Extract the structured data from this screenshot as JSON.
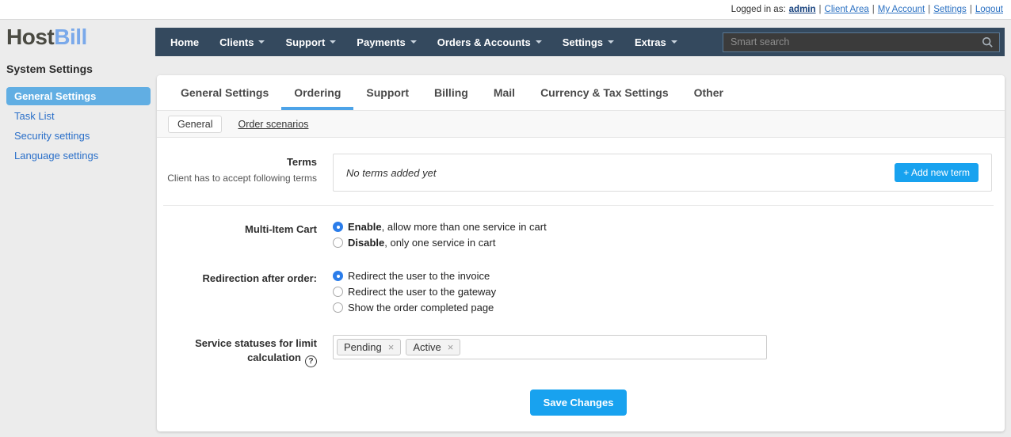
{
  "topbar": {
    "prefix": "Logged in as:",
    "username": "admin",
    "separator": "|",
    "links": [
      "Client Area",
      "My Account",
      "Settings",
      "Logout"
    ]
  },
  "brand": {
    "name_primary": "Host",
    "name_secondary": "Bill",
    "section_title": "System Settings"
  },
  "nav": {
    "items": [
      "Home",
      "Clients",
      "Support",
      "Payments",
      "Orders & Accounts",
      "Settings",
      "Extras"
    ],
    "search_placeholder": "Smart search"
  },
  "sidebar": {
    "items": [
      {
        "label": "General Settings",
        "active": true
      },
      {
        "label": "Task List",
        "active": false
      },
      {
        "label": "Security settings",
        "active": false
      },
      {
        "label": "Language settings",
        "active": false
      }
    ]
  },
  "tabs": {
    "active": "Ordering",
    "items": [
      "General Settings",
      "Ordering",
      "Support",
      "Billing",
      "Mail",
      "Currency & Tax Settings",
      "Other"
    ]
  },
  "subtabs": {
    "active": "General",
    "items": [
      "General",
      "Order scenarios"
    ]
  },
  "form": {
    "terms": {
      "label": "Terms",
      "description": "Client has to accept following terms",
      "empty_message": "No terms added yet",
      "add_button": "+ Add new term"
    },
    "multi_item_cart": {
      "label": "Multi-Item Cart",
      "options": [
        {
          "emphasis": "Enable",
          "rest": ", allow more than one service in cart",
          "selected": true
        },
        {
          "emphasis": "Disable",
          "rest": ", only one service in cart",
          "selected": false
        }
      ]
    },
    "redirection": {
      "label": "Redirection after order:",
      "options": [
        {
          "label": "Redirect the user to the invoice",
          "selected": true
        },
        {
          "label": "Redirect the user to the gateway",
          "selected": false
        },
        {
          "label": "Show the order completed page",
          "selected": false
        }
      ]
    },
    "service_statuses": {
      "label": "Service statuses for limit calculation",
      "help_icon": "?",
      "remove_icon": "×",
      "tags": [
        "Pending",
        "Active"
      ]
    }
  },
  "actions": {
    "save_button": "Save Changes"
  },
  "colors": {
    "accent_blue": "#18a2ef",
    "nav_background": "#34495e",
    "sidebar_active": "#61aee3",
    "link_blue": "#2a70c2",
    "tab_active_underline": "#4da3e8"
  }
}
